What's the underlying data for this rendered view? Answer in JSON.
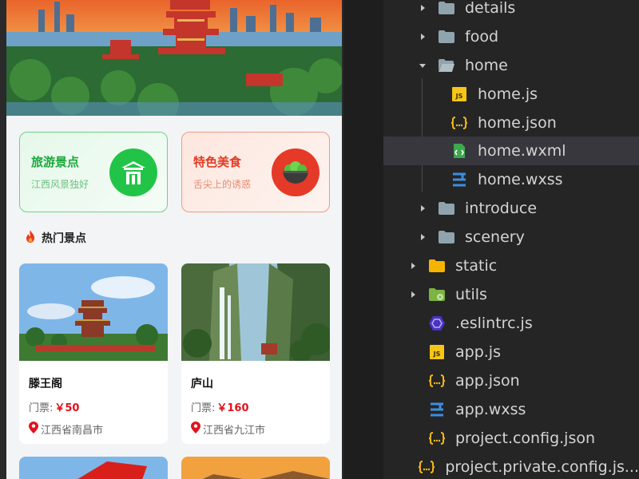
{
  "categories": [
    {
      "title": "旅游景点",
      "subtitle": "江西风景独好",
      "icon": "pavilion-icon",
      "color": "#22c447"
    },
    {
      "title": "特色美食",
      "subtitle": "舌尖上的诱惑",
      "icon": "food-bowl-icon",
      "color": "#e53a28"
    }
  ],
  "section": {
    "title": "热门景点",
    "icon": "fire-icon"
  },
  "spots": [
    {
      "name": "滕王阁",
      "price_label": "门票:",
      "price": "￥50",
      "location": "江西省南昌市"
    },
    {
      "name": "庐山",
      "price_label": "门票:",
      "price": "￥160",
      "location": "江西省九江市"
    }
  ],
  "explorer": {
    "items": [
      {
        "label": "details",
        "type": "folder",
        "expanded": false
      },
      {
        "label": "food",
        "type": "folder",
        "expanded": false
      },
      {
        "label": "home",
        "type": "folder",
        "expanded": true
      },
      {
        "label": "home.js",
        "type": "js"
      },
      {
        "label": "home.json",
        "type": "json"
      },
      {
        "label": "home.wxml",
        "type": "wxml",
        "selected": true
      },
      {
        "label": "home.wxss",
        "type": "wxss"
      },
      {
        "label": "introduce",
        "type": "folder",
        "expanded": false
      },
      {
        "label": "scenery",
        "type": "folder",
        "expanded": false
      },
      {
        "label": "static",
        "type": "folder-static",
        "expanded": false
      },
      {
        "label": "utils",
        "type": "folder-utils",
        "expanded": false
      },
      {
        "label": ".eslintrc.js",
        "type": "eslint"
      },
      {
        "label": "app.js",
        "type": "js"
      },
      {
        "label": "app.json",
        "type": "json"
      },
      {
        "label": "app.wxss",
        "type": "wxss"
      },
      {
        "label": "project.config.json",
        "type": "json"
      },
      {
        "label": "project.private.config.js...",
        "type": "json"
      }
    ]
  },
  "colors": {
    "accent_green": "#22c447",
    "accent_red": "#e53a28",
    "price_red": "#e3121b",
    "selected_row": "#37373d"
  }
}
